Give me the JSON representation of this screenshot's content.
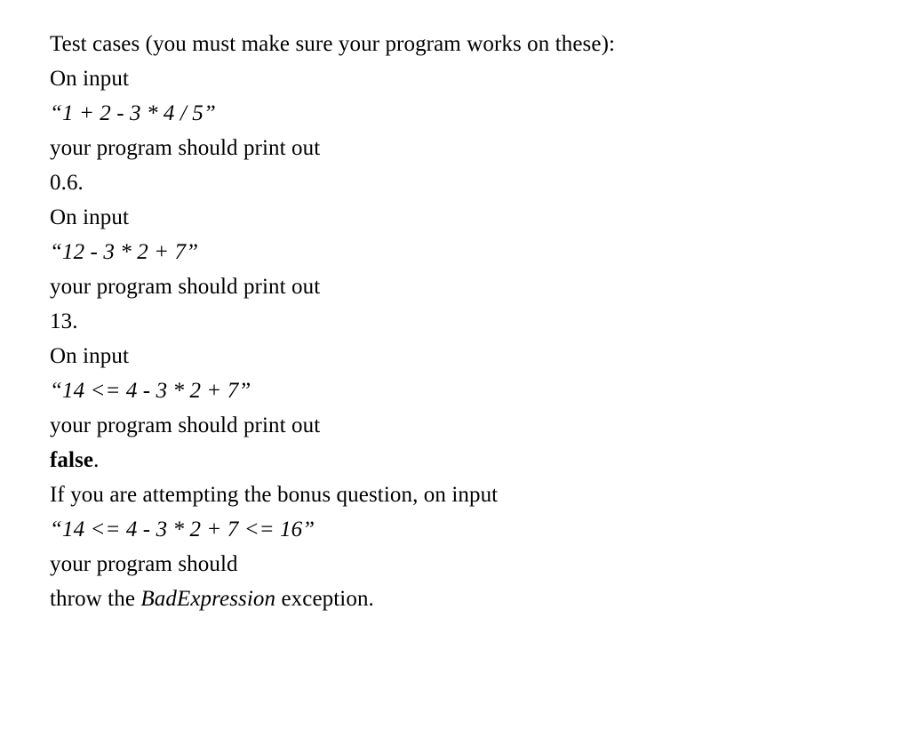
{
  "lines": {
    "l1": "Test cases (you must make sure your program works on these):",
    "l2": "On input",
    "l3": "“1 + 2 - 3 * 4 / 5”",
    "l4": "your program should print out",
    "l5": "0.6.",
    "l6": "On input",
    "l7": "“12 - 3 * 2 + 7”",
    "l8": "your program should print out",
    "l9": "13.",
    "l10": "On input",
    "l11": "“14 <= 4 - 3 * 2 + 7”",
    "l12": "your program should print out",
    "l13_bold": "false",
    "l13_tail": ".",
    "l14": "If you are attempting the bonus question, on input",
    "l15": "“14 <= 4 - 3 * 2 + 7 <= 16”",
    "l16": "your program should",
    "l17_pre": "throw the ",
    "l17_italic": "BadExpression",
    "l17_post": " exception."
  }
}
